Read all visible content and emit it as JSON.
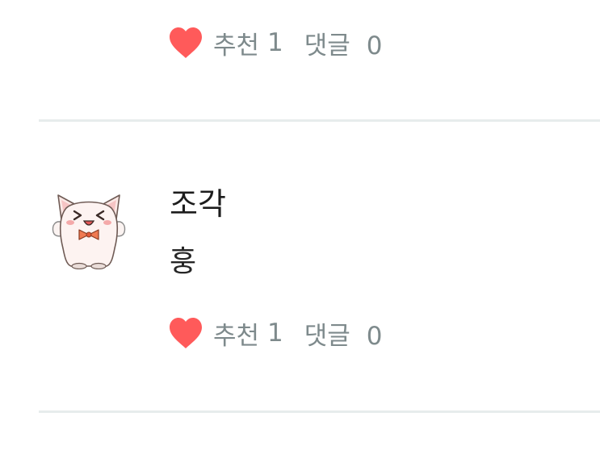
{
  "comments": [
    {
      "partial": true,
      "like_label": "추천",
      "like_count": "1",
      "reply_label": "댓글",
      "reply_count": "0"
    },
    {
      "author": "조각",
      "text": "훙",
      "avatar_icon": "white-cat-bowtie-avatar",
      "like_label": "추천",
      "like_count": "1",
      "reply_label": "댓글",
      "reply_count": "0"
    }
  ],
  "colors": {
    "heart": "#ff5a5a",
    "meta_text": "#7e8a8c",
    "divider": "#e7ecec",
    "author_text": "#1d1d1d"
  }
}
